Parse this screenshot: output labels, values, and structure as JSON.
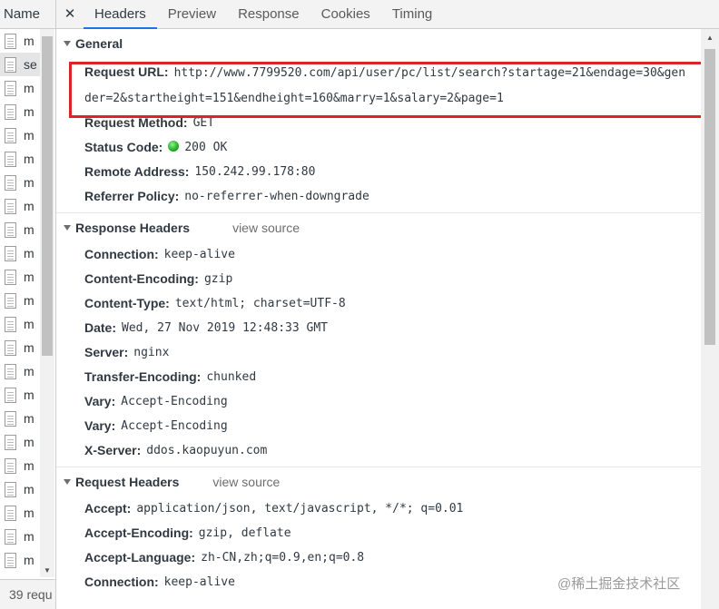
{
  "left_panel": {
    "header": "Name",
    "rows": [
      "m",
      "se",
      "m",
      "m",
      "m",
      "m",
      "m",
      "m",
      "m",
      "m",
      "m",
      "m",
      "m",
      "m",
      "m",
      "m",
      "m",
      "m",
      "m",
      "m",
      "m",
      "m",
      "m"
    ],
    "selected_index": 1,
    "footer": "39 requ"
  },
  "tabs": {
    "close_glyph": "✕",
    "items": [
      "Headers",
      "Preview",
      "Response",
      "Cookies",
      "Timing"
    ],
    "active_index": 0
  },
  "general": {
    "title": "General",
    "request_url_label": "Request URL:",
    "request_url": "http://www.7799520.com/api/user/pc/list/search?startage=21&endage=30&gender=2&startheight=151&endheight=160&marry=1&salary=2&page=1",
    "request_method_label": "Request Method:",
    "request_method": "GET",
    "status_code_label": "Status Code:",
    "status_code": "200 OK",
    "remote_address_label": "Remote Address:",
    "remote_address": "150.242.99.178:80",
    "referrer_policy_label": "Referrer Policy:",
    "referrer_policy": "no-referrer-when-downgrade"
  },
  "response_headers": {
    "title": "Response Headers",
    "view_source": "view source",
    "items": [
      {
        "key": "Connection:",
        "value": "keep-alive"
      },
      {
        "key": "Content-Encoding:",
        "value": "gzip"
      },
      {
        "key": "Content-Type:",
        "value": "text/html; charset=UTF-8"
      },
      {
        "key": "Date:",
        "value": "Wed, 27 Nov 2019 12:48:33 GMT"
      },
      {
        "key": "Server:",
        "value": "nginx"
      },
      {
        "key": "Transfer-Encoding:",
        "value": "chunked"
      },
      {
        "key": "Vary:",
        "value": "Accept-Encoding"
      },
      {
        "key": "Vary:",
        "value": "Accept-Encoding"
      },
      {
        "key": "X-Server:",
        "value": "ddos.kaopuyun.com"
      }
    ]
  },
  "request_headers": {
    "title": "Request Headers",
    "view_source": "view source",
    "items": [
      {
        "key": "Accept:",
        "value": "application/json, text/javascript, */*; q=0.01"
      },
      {
        "key": "Accept-Encoding:",
        "value": "gzip, deflate"
      },
      {
        "key": "Accept-Language:",
        "value": "zh-CN,zh;q=0.9,en;q=0.8"
      },
      {
        "key": "Connection:",
        "value": "keep-alive"
      }
    ]
  },
  "watermark": "@稀土掘金技术社区",
  "colors": {
    "highlight_box": "#e0202a",
    "active_tab_underline": "#1a73e8",
    "status_ok": "#1fae1f"
  }
}
